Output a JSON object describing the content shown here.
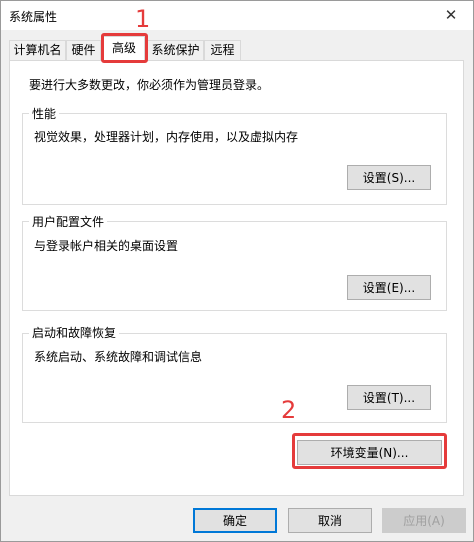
{
  "window": {
    "title": "系统属性",
    "close_glyph": "✕"
  },
  "tabs": [
    {
      "label": "计算机名"
    },
    {
      "label": "硬件"
    },
    {
      "label": "高级"
    },
    {
      "label": "系统保护"
    },
    {
      "label": "远程"
    }
  ],
  "intro_text": "要进行大多数更改，你必须作为管理员登录。",
  "groups": {
    "performance": {
      "label": "性能",
      "desc": "视觉效果，处理器计划，内存使用，以及虚拟内存",
      "button": "设置(S)..."
    },
    "profiles": {
      "label": "用户配置文件",
      "desc": "与登录帐户相关的桌面设置",
      "button": "设置(E)..."
    },
    "startup": {
      "label": "启动和故障恢复",
      "desc": "系统启动、系统故障和调试信息",
      "button": "设置(T)..."
    }
  },
  "env_button": "环境变量(N)...",
  "footer": {
    "ok": "确定",
    "cancel": "取消",
    "apply": "应用(A)"
  },
  "annotations": {
    "step1": "1",
    "step2": "2"
  },
  "colors": {
    "annotation": "#e53b3b",
    "default_button_border": "#0078d7"
  }
}
